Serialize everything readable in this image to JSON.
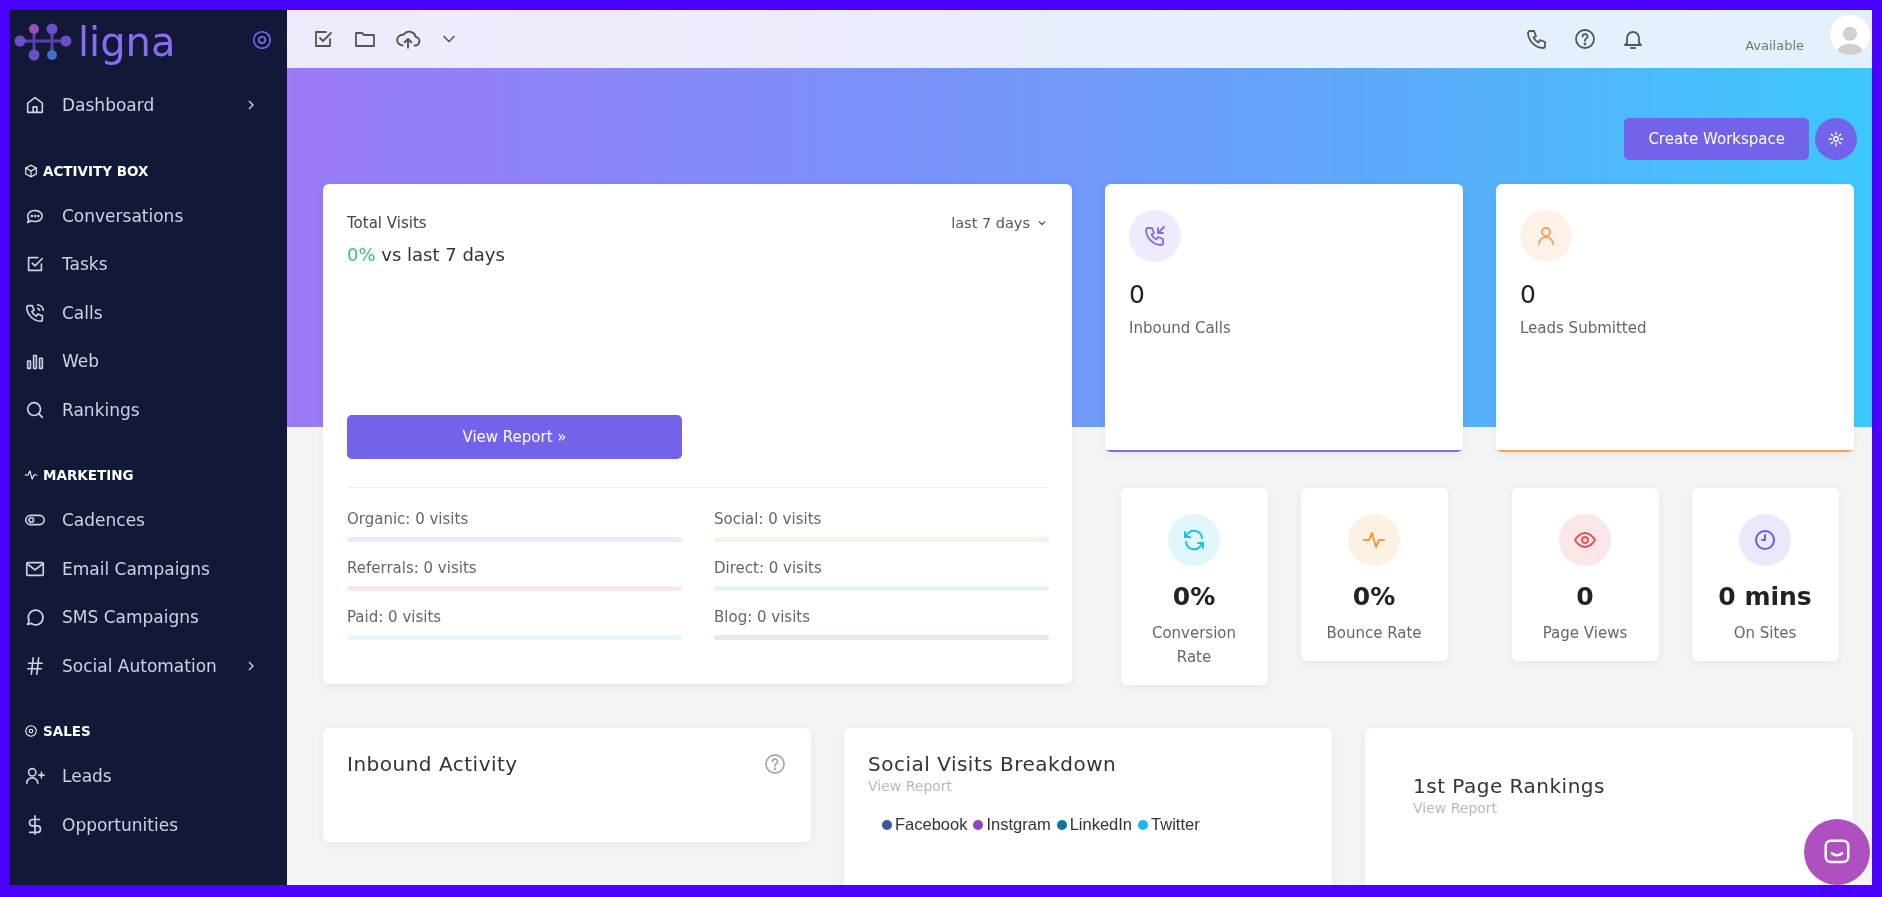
{
  "logo": {
    "text": "ligna"
  },
  "sidebar": {
    "sections": [
      {
        "items": [
          {
            "label": "Dashboard",
            "submenu": true
          }
        ]
      },
      {
        "heading": "ACTIVITY BOX",
        "items": [
          {
            "label": "Conversations",
            "submenu": false
          },
          {
            "label": "Tasks",
            "submenu": false
          },
          {
            "label": "Calls",
            "submenu": false
          },
          {
            "label": "Web",
            "submenu": false
          },
          {
            "label": "Rankings",
            "submenu": false
          }
        ]
      },
      {
        "heading": "MARKETING",
        "items": [
          {
            "label": "Cadences",
            "submenu": false
          },
          {
            "label": "Email Campaigns",
            "submenu": false
          },
          {
            "label": "SMS Campaigns",
            "submenu": false
          },
          {
            "label": "Social Automation",
            "submenu": true
          }
        ]
      },
      {
        "heading": "SALES",
        "items": [
          {
            "label": "Leads",
            "submenu": false
          },
          {
            "label": "Opportunities",
            "submenu": false
          }
        ]
      }
    ]
  },
  "topbar": {
    "status": "Available"
  },
  "create_workspace_button": "Create Workspace",
  "total_visits": {
    "title": "Total Visits",
    "range": "last 7 days",
    "change": "0%",
    "change_text": "vs last 7 days",
    "button": "View Report »",
    "sources": [
      {
        "label": "Organic: 0 visits",
        "color": "#ece9fd"
      },
      {
        "label": "Social: 0 visits",
        "color": "#fdeee6"
      },
      {
        "label": "Referrals: 0 visits",
        "color": "#fce8e8"
      },
      {
        "label": "Direct: 0 visits",
        "color": "#e5f6f2"
      },
      {
        "label": "Paid: 0 visits",
        "color": "#e3f8fb"
      },
      {
        "label": "Blog: 0 visits",
        "color": "#eee2ec"
      }
    ]
  },
  "stat_cards": [
    {
      "value": "0",
      "label": "Inbound Calls",
      "color": "#7b6ff0"
    },
    {
      "value": "0",
      "label": "Leads Submitted",
      "color": "#f5a05a"
    }
  ],
  "metric_cards": [
    {
      "value": "0%",
      "label": "Conversion Rate",
      "color": "#1cc2de"
    },
    {
      "value": "0%",
      "label": "Bounce Rate",
      "color": "#f2993f"
    },
    {
      "value": "0",
      "label": "Page Views",
      "color": "#e0565b"
    },
    {
      "value": "0 mins",
      "label": "On Sites",
      "color": "#6a5be5"
    }
  ],
  "inbound_activity": {
    "title": "Inbound Activity"
  },
  "social_visits": {
    "title": "Social Visits Breakdown",
    "link": "View Report",
    "legend": [
      {
        "label": "Facebook",
        "color": "#3b5998"
      },
      {
        "label": "Instgram",
        "color": "#8e44c4"
      },
      {
        "label": "LinkedIn",
        "color": "#0e76a8"
      },
      {
        "label": "Twitter",
        "color": "#1ab7ea"
      }
    ]
  },
  "rankings": {
    "title": "1st Page Rankings",
    "link": "View Report"
  }
}
